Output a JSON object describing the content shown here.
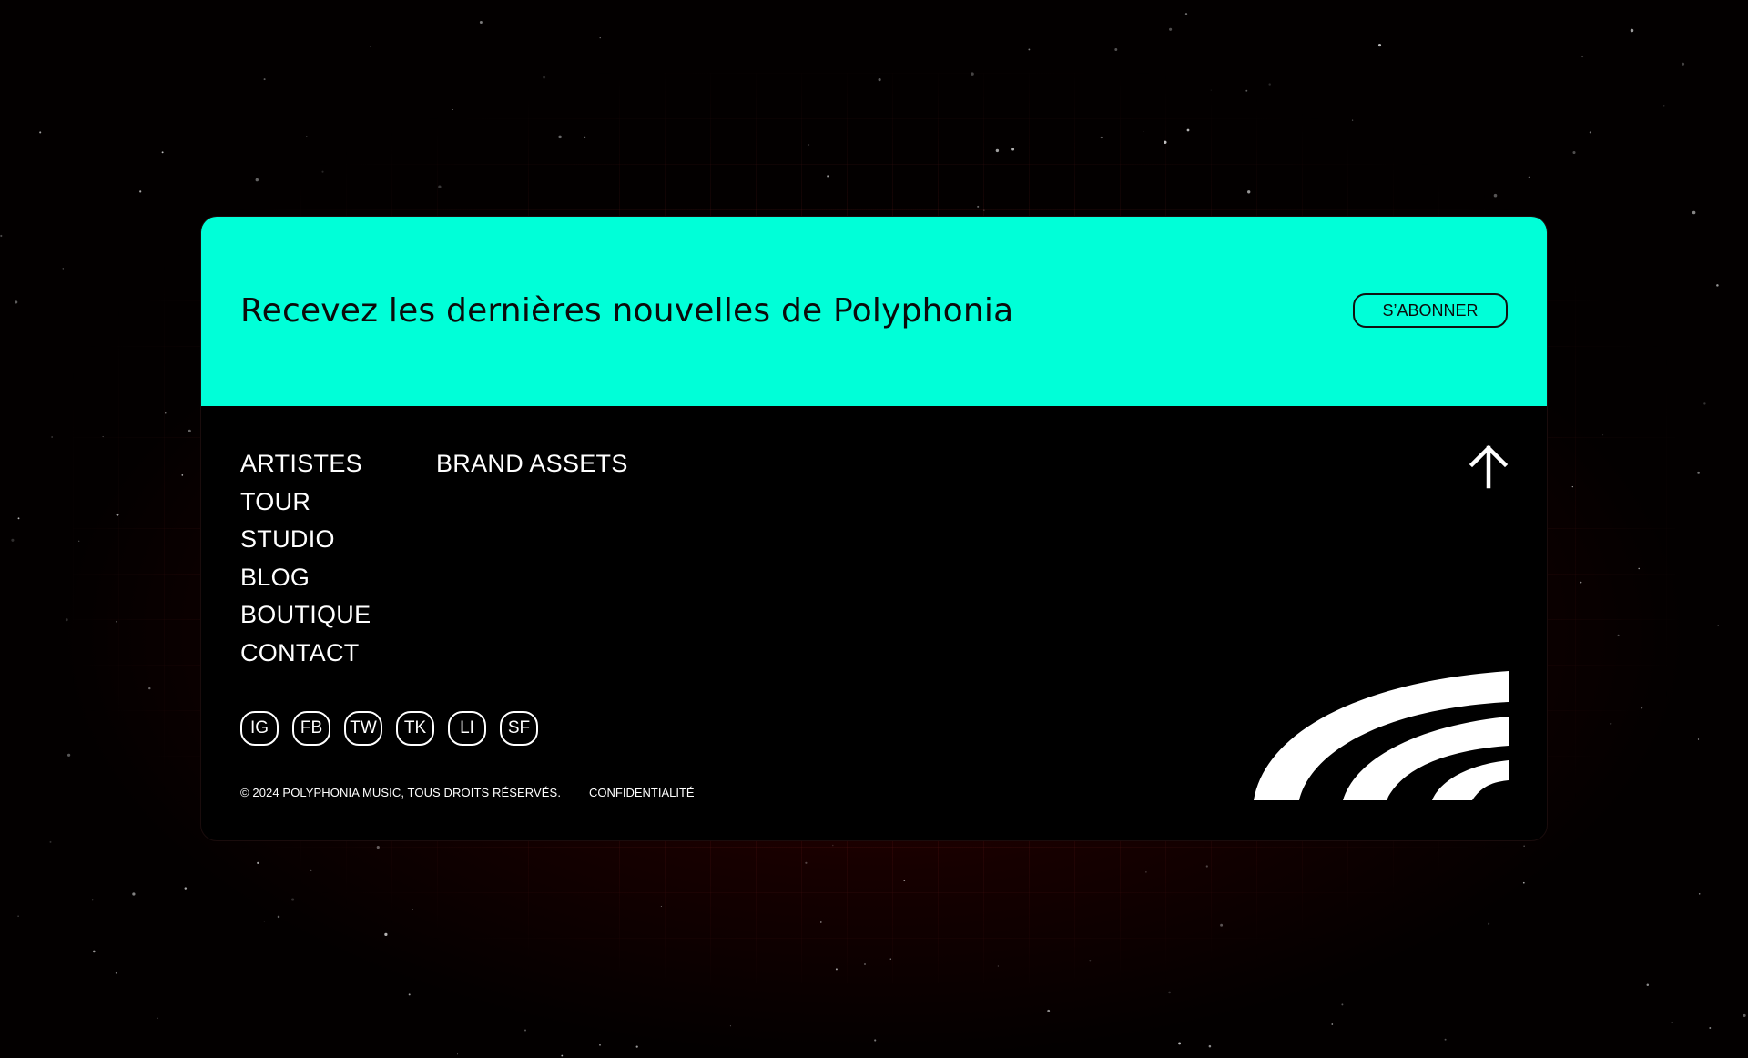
{
  "newsletter": {
    "title": "Recevez les dernières nouvelles de Polyphonia",
    "subscribe_label": "S’ABONNER"
  },
  "nav": {
    "primary": [
      "ARTISTES",
      "TOUR",
      "STUDIO",
      "BLOG",
      "BOUTIQUE",
      "CONTACT"
    ],
    "secondary": [
      "BRAND ASSETS"
    ]
  },
  "social": [
    "IG",
    "FB",
    "TW",
    "TK",
    "LI",
    "SF"
  ],
  "legal": {
    "copyright": "© 2024 POLYPHONIA MUSIC, TOUS DROITS RÉSERVÉS.",
    "privacy": "CONFIDENTIALITÉ"
  },
  "icons": {
    "back_to_top": "arrow-up-icon",
    "logo": "polyphonia-arcs-logo"
  },
  "colors": {
    "accent": "#00ffd8",
    "card": "#000000",
    "text": "#ffffff"
  }
}
